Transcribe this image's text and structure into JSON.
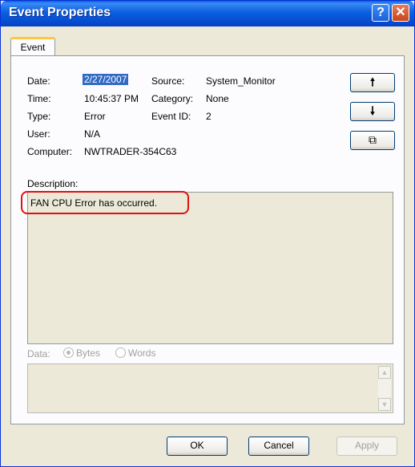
{
  "window": {
    "title": "Event Properties"
  },
  "tabs": [
    {
      "label": "Event"
    }
  ],
  "fields": {
    "date_label": "Date:",
    "date_value": "2/27/2007",
    "source_label": "Source:",
    "source_value": "System_Monitor",
    "time_label": "Time:",
    "time_value": "10:45:37 PM",
    "category_label": "Category:",
    "category_value": "None",
    "type_label": "Type:",
    "type_value": "Error",
    "eventid_label": "Event ID:",
    "eventid_value": "2",
    "user_label": "User:",
    "user_value": "N/A",
    "computer_label": "Computer:",
    "computer_value": "NWTRADER-354C63"
  },
  "side_buttons": {
    "up": "🠕",
    "down": "🠗",
    "copy": "⧉"
  },
  "description": {
    "label": "Description:",
    "text": "FAN CPU Error has occurred."
  },
  "data": {
    "label": "Data:",
    "bytes": "Bytes",
    "words": "Words",
    "selected": "Bytes"
  },
  "buttons": {
    "ok": "OK",
    "cancel": "Cancel",
    "apply": "Apply"
  },
  "colors": {
    "title_bar": "#0a5fe0",
    "selection": "#316ac5",
    "highlight_ring": "#e01010",
    "window_bg": "#ece9d8"
  }
}
